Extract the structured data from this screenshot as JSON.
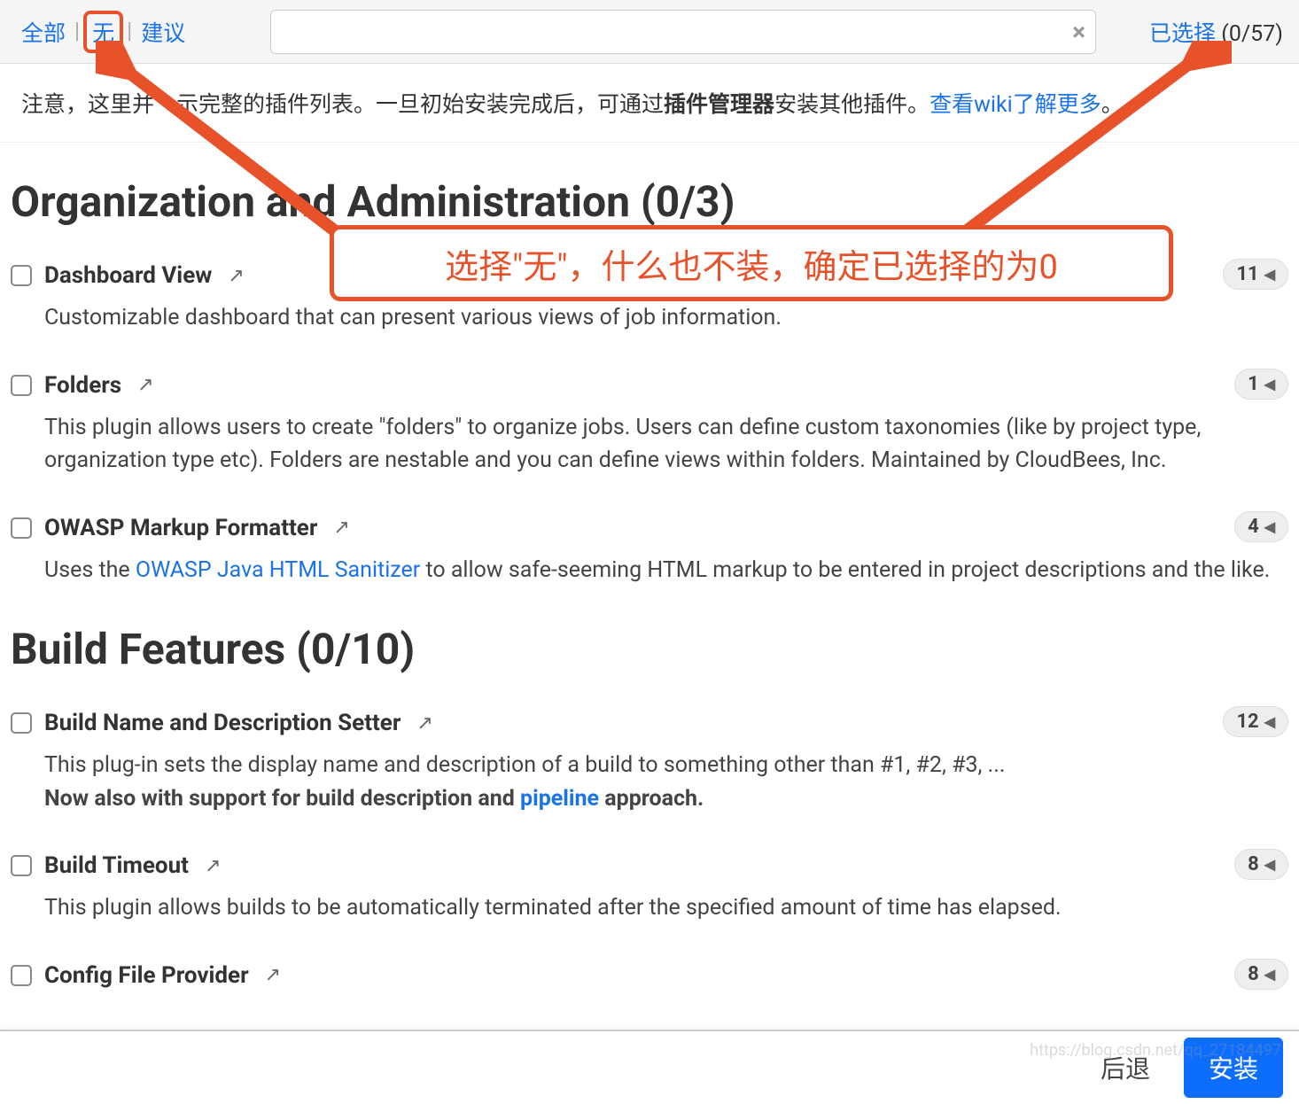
{
  "header": {
    "all": "全部",
    "none": "无",
    "suggest": "建议",
    "selected_prefix": "已选择",
    "selected_count": " (0/57)"
  },
  "notice": {
    "t1": "注意，这里并",
    "t2": "示完整的插件列表。一旦初始安装完成后，可通过",
    "bold": "插件管理器",
    "t3": "安装其他插件。",
    "link": "查看wiki了解更多"
  },
  "sections": [
    {
      "heading": "Organization and Administration (0/3)",
      "plugins": [
        {
          "title": "Dashboard View",
          "badge": "11",
          "desc": [
            {
              "text": "Customizable dashboard that can present various views of job information."
            }
          ]
        },
        {
          "title": "Folders",
          "badge": "1",
          "desc": [
            {
              "text": "This plugin allows users to create \"folders\" to organize jobs. Users can define custom taxonomies (like by project type, organization type etc). Folders are nestable and you can define views within folders. Maintained by CloudBees, Inc."
            }
          ]
        },
        {
          "title": "OWASP Markup Formatter",
          "badge": "4",
          "desc": [
            {
              "text": "Uses the "
            },
            {
              "link": "OWASP Java HTML Sanitizer"
            },
            {
              "text": " to allow safe-seeming HTML markup to be entered in project descriptions and the like."
            }
          ]
        }
      ]
    },
    {
      "heading": "Build Features (0/10)",
      "plugins": [
        {
          "title": "Build Name and Description Setter",
          "badge": "12",
          "desc": [
            {
              "text": "This plug-in sets the display name and description of a build to something other than #1, #2, #3, ..."
            },
            {
              "br": true
            },
            {
              "bold": "Now also with support for build description and "
            },
            {
              "boldlink": "pipeline"
            },
            {
              "bold": " approach."
            }
          ]
        },
        {
          "title": "Build Timeout",
          "badge": "8",
          "desc": [
            {
              "text": "This plugin allows builds to be automatically terminated after the specified amount of time has elapsed."
            }
          ]
        },
        {
          "title": "Config File Provider",
          "badge": "8",
          "desc": []
        }
      ]
    }
  ],
  "annotation": "选择\"无\"，什么也不装，确定已选择的为0",
  "footer": {
    "back": "后退",
    "install": "安装"
  },
  "watermark": "https://blog.csdn.net/qq_27184497"
}
